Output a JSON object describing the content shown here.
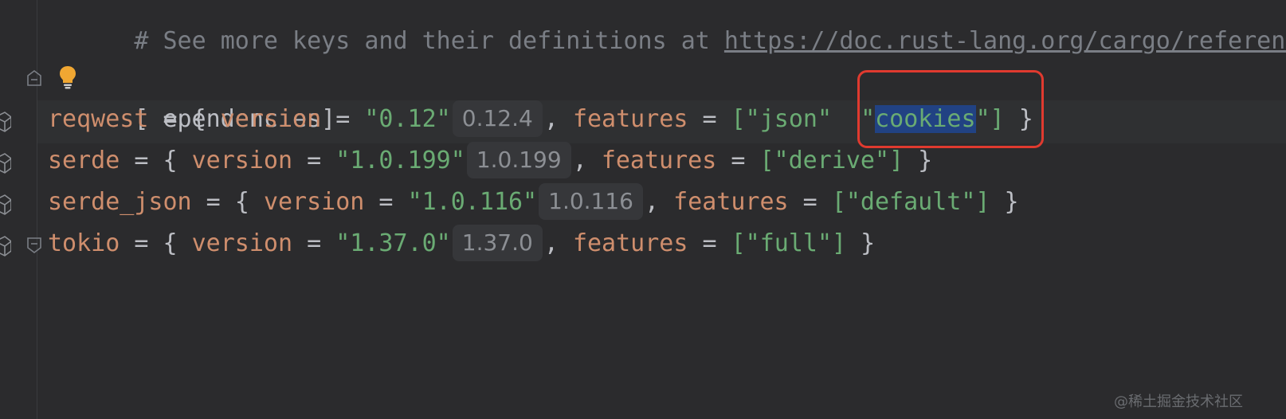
{
  "comment_line": {
    "prefix": "# See more keys and their definitions at ",
    "link": "https://doc.rust-lang.org/cargo/reference"
  },
  "section": {
    "open_bracket": "[",
    "name": "dependencies",
    "name_tail": "ependencies",
    "close_bracket": "]"
  },
  "dependencies": [
    {
      "name": "reqwest",
      "version": "\"0.12\"",
      "resolved": "0.12.4",
      "features_before": "[\"json\"",
      "features_highlighted": "cookies",
      "features_after": "\"]"
    },
    {
      "name": "serde",
      "version": "\"1.0.199\"",
      "resolved": "1.0.199",
      "features": "[\"derive\"]"
    },
    {
      "name": "serde_json",
      "version": "\"1.0.116\"",
      "resolved": "1.0.116",
      "features": "[\"default\"]"
    },
    {
      "name": "tokio",
      "version": "\"1.37.0\"",
      "resolved": "1.37.0",
      "features": "[\"full\"]"
    }
  ],
  "tokens": {
    "version_key": "version",
    "features_key": "features",
    "eq": " = ",
    "open_brace": "{ ",
    "close_brace": " }",
    "comma": ", ",
    "quote": "\""
  },
  "watermark": "@稀土掘金技术社区",
  "colors": {
    "background": "#2b2b2d",
    "keyword": "#cf8e6d",
    "string": "#6aab73",
    "selection": "#214283",
    "annotation_box": "#e03a2f"
  },
  "icons": [
    "fold-icon",
    "lightbulb-icon",
    "package-icon"
  ]
}
